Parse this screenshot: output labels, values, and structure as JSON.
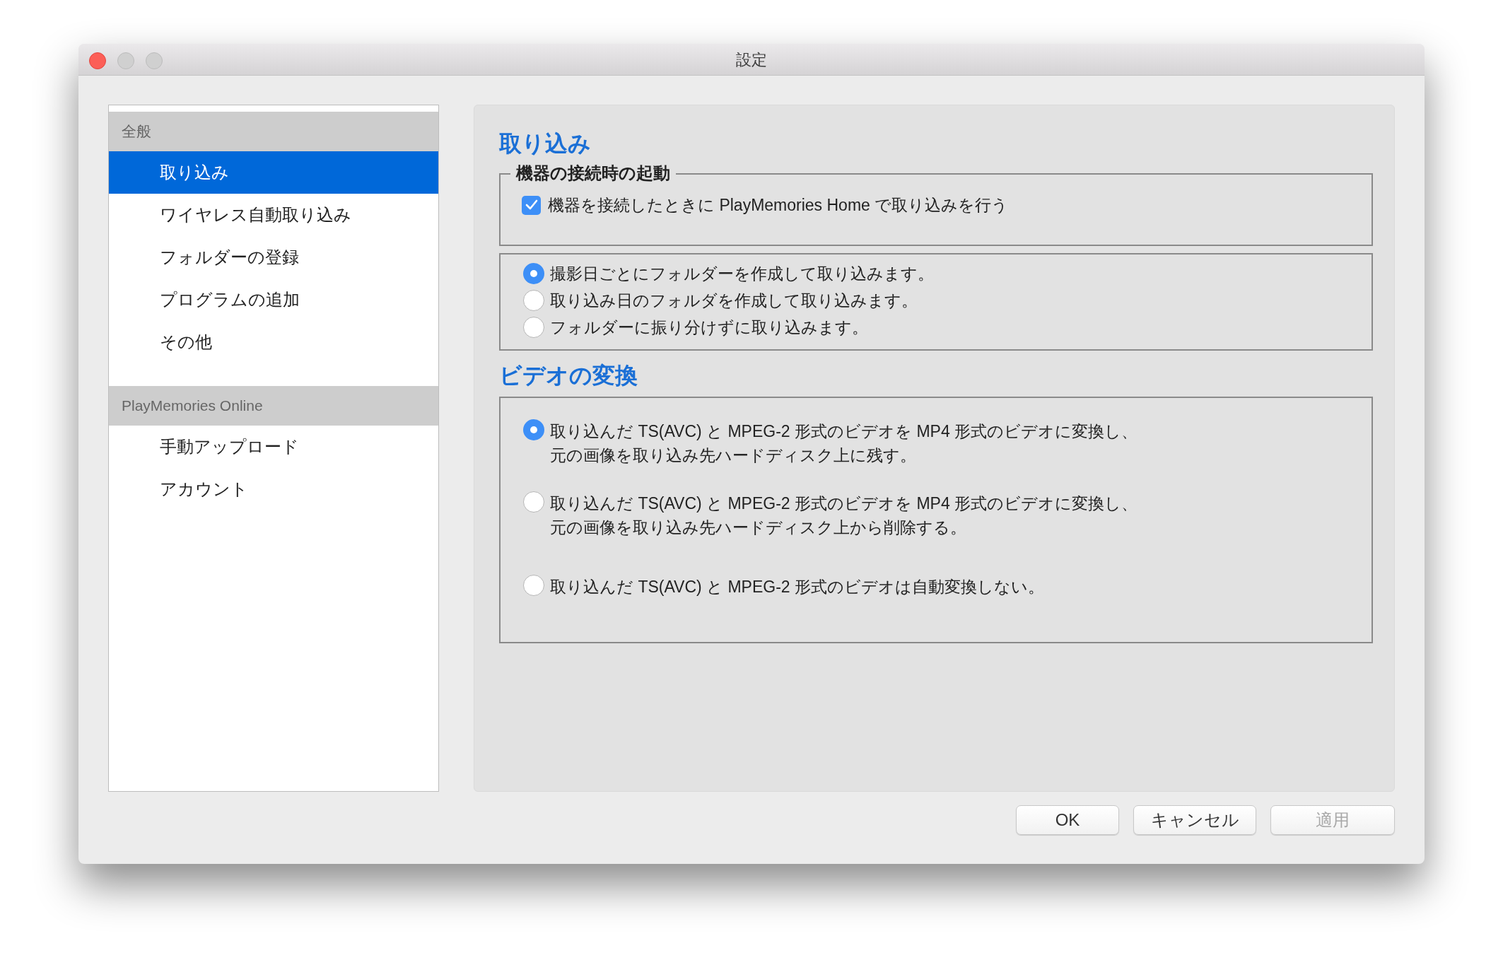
{
  "window": {
    "title": "設定"
  },
  "sidebar": {
    "groups": [
      {
        "header": "全般",
        "items": [
          {
            "label": "取り込み",
            "selected": true
          },
          {
            "label": "ワイヤレス自動取り込み",
            "selected": false
          },
          {
            "label": "フォルダーの登録",
            "selected": false
          },
          {
            "label": "プログラムの追加",
            "selected": false
          },
          {
            "label": "その他",
            "selected": false
          }
        ]
      },
      {
        "header": "PlayMemories Online",
        "items": [
          {
            "label": "手動アップロード",
            "selected": false
          },
          {
            "label": "アカウント",
            "selected": false
          }
        ]
      }
    ]
  },
  "import_section": {
    "title": "取り込み",
    "launch_group": {
      "legend": "機器の接続時の起動",
      "checkbox": {
        "label": "機器を接続したときに PlayMemories Home で取り込みを行う",
        "checked": true
      }
    },
    "folder_options": [
      {
        "label": "撮影日ごとにフォルダーを作成して取り込みます。",
        "selected": true
      },
      {
        "label": "取り込み日のフォルダを作成して取り込みます。",
        "selected": false
      },
      {
        "label": "フォルダーに振り分けずに取り込みます。",
        "selected": false
      }
    ]
  },
  "video_section": {
    "title": "ビデオの変換",
    "options": [
      {
        "lines": [
          "取り込んだ TS(AVC) と MPEG-2 形式のビデオを MP4 形式のビデオに変換し、",
          "元の画像を取り込み先ハードディスク上に残す。"
        ],
        "selected": true
      },
      {
        "lines": [
          "取り込んだ TS(AVC) と MPEG-2 形式のビデオを MP4 形式のビデオに変換し、",
          "元の画像を取り込み先ハードディスク上から削除する。"
        ],
        "selected": false
      },
      {
        "lines": [
          "取り込んだ TS(AVC) と MPEG-2 形式のビデオは自動変換しない。"
        ],
        "selected": false
      }
    ]
  },
  "buttons": [
    {
      "label": "OK",
      "disabled": false
    },
    {
      "label": "キャンセル",
      "disabled": false
    },
    {
      "label": "適用",
      "disabled": true
    }
  ]
}
